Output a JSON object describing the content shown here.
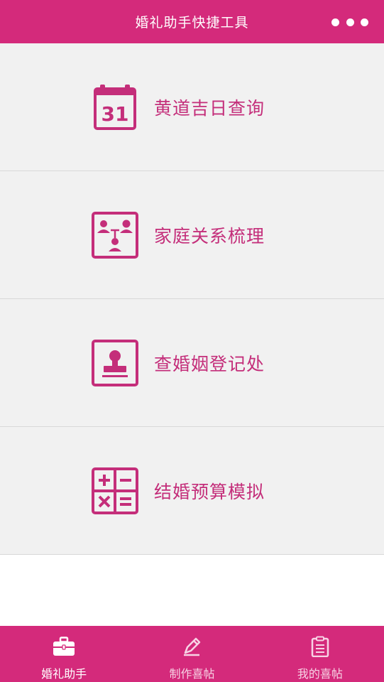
{
  "header": {
    "title": "婚礼助手快捷工具"
  },
  "menu": {
    "items": [
      {
        "label": "黄道吉日查询",
        "icon": "calendar-icon",
        "calendar_day": "31"
      },
      {
        "label": "家庭关系梳理",
        "icon": "family-tree-icon"
      },
      {
        "label": "查婚姻登记处",
        "icon": "registry-stamp-icon"
      },
      {
        "label": "结婚预算模拟",
        "icon": "calculator-icon"
      }
    ]
  },
  "tabbar": {
    "tabs": [
      {
        "label": "婚礼助手",
        "icon": "briefcase-icon",
        "active": true
      },
      {
        "label": "制作喜帖",
        "icon": "pencil-icon",
        "active": false
      },
      {
        "label": "我的喜帖",
        "icon": "clipboard-icon",
        "active": false
      }
    ]
  },
  "colors": {
    "brand": "#d42a7b",
    "item_text": "#c42e7a",
    "item_background": "#f1f1f1"
  }
}
